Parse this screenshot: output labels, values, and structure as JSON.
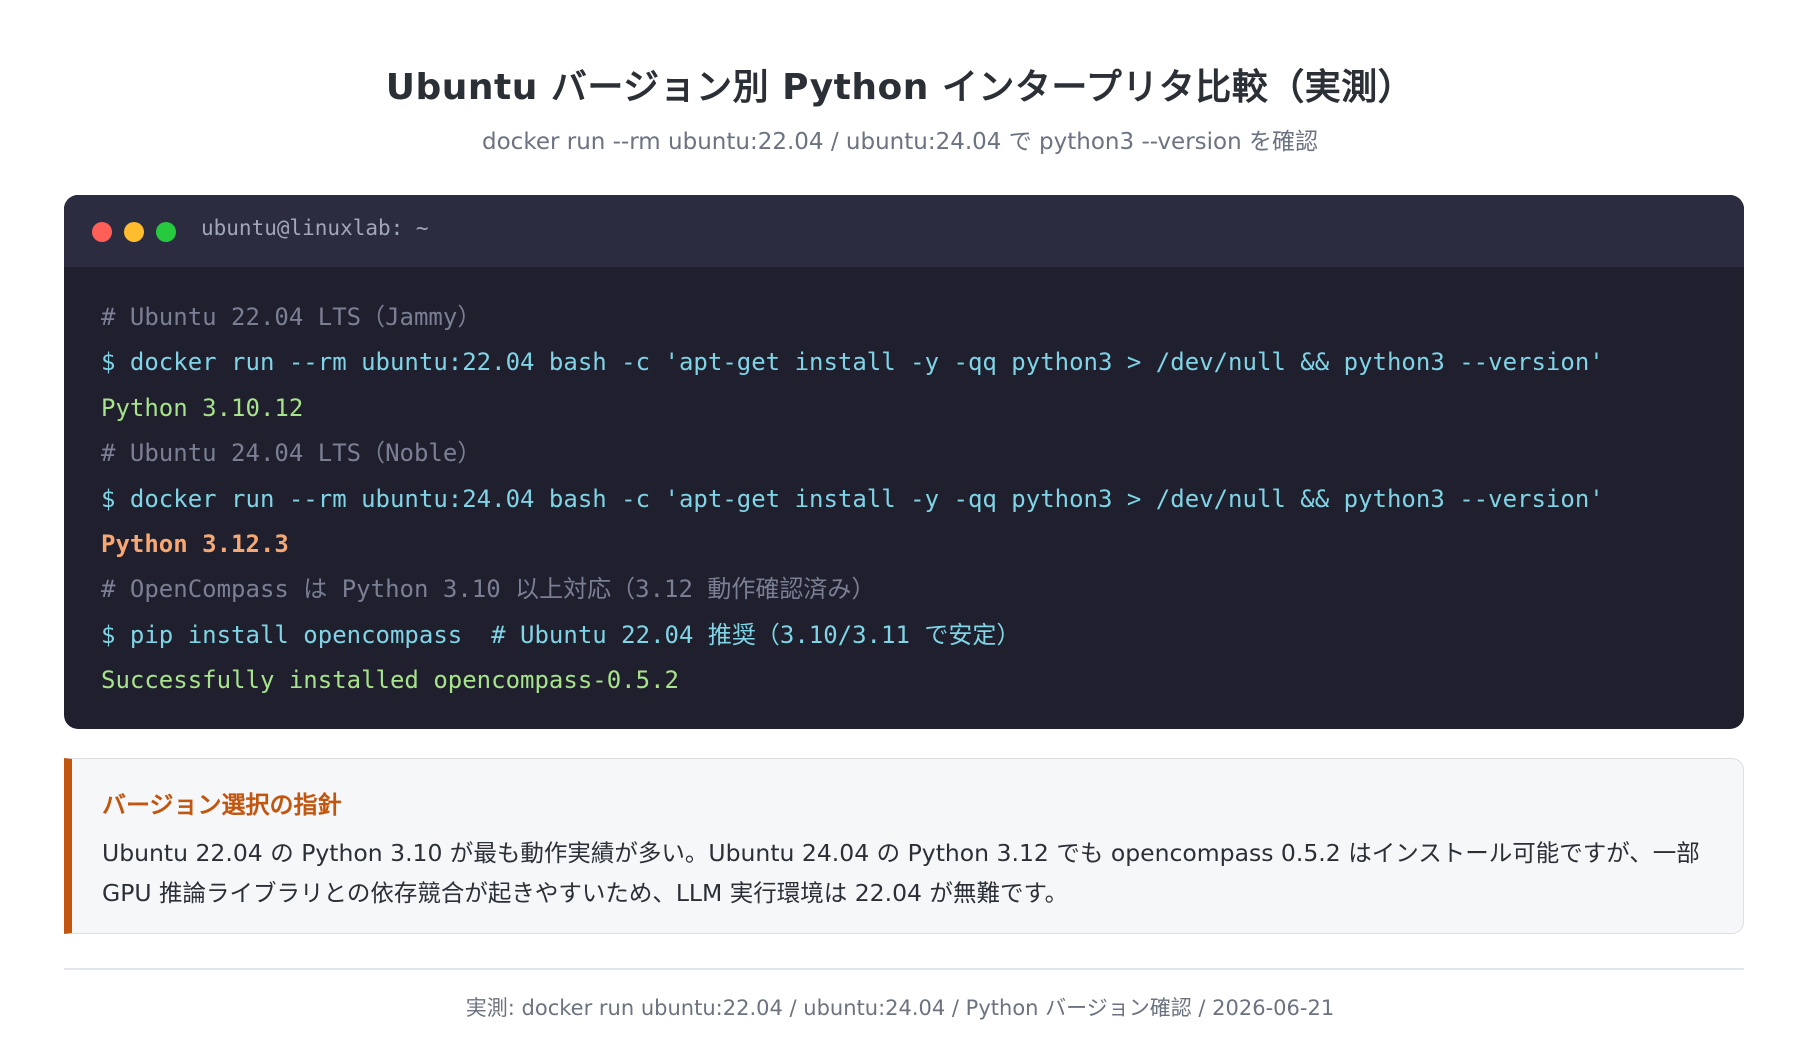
{
  "header": {
    "title": "Ubuntu バージョン別 Python インタープリタ比較（実測）",
    "subtitle": "docker run --rm ubuntu:22.04 / ubuntu:24.04 で python3 --version を確認"
  },
  "terminal": {
    "window_title": "ubuntu@linuxlab: ~",
    "lines": [
      {
        "kind": "comment",
        "text": "# Ubuntu 22.04 LTS（Jammy）"
      },
      {
        "kind": "cmd",
        "text": "$ docker run --rm ubuntu:22.04 bash -c 'apt-get install -y -qq python3 > /dev/null && python3 --version'"
      },
      {
        "kind": "ok",
        "text": "Python 3.10.12"
      },
      {
        "kind": "comment",
        "text": "# Ubuntu 24.04 LTS（Noble）"
      },
      {
        "kind": "cmd",
        "text": "$ docker run --rm ubuntu:24.04 bash -c 'apt-get install -y -qq python3 > /dev/null && python3 --version'"
      },
      {
        "kind": "warn",
        "text": "Python 3.12.3"
      },
      {
        "kind": "comment",
        "text": "# OpenCompass は Python 3.10 以上対応（3.12 動作確認済み）"
      },
      {
        "kind": "cmd",
        "text": "$ pip install opencompass  # Ubuntu 22.04 推奨（3.10/3.11 で安定）"
      },
      {
        "kind": "ok",
        "text": "Successfully installed opencompass-0.5.2"
      }
    ]
  },
  "note": {
    "title": "バージョン選択の指針",
    "text": "Ubuntu 22.04 の Python 3.10 が最も動作実績が多い。Ubuntu 24.04 の Python 3.12 でも opencompass 0.5.2 はインストール可能ですが、一部 GPU 推論ライブラリとの依存競合が起きやすいため、LLM 実行環境は 22.04 が無難です。"
  },
  "footer": {
    "text": "実測: docker run ubuntu:22.04 / ubuntu:24.04 / Python バージョン確認 / 2026-06-21"
  },
  "colors": {
    "terminal_bg": "#1f1f2e",
    "terminal_bar": "#2c2c40",
    "comment": "#7a7f94",
    "command": "#7fd4e6",
    "success": "#a6e38a",
    "highlight": "#f7a872",
    "accent": "#c2560f"
  }
}
